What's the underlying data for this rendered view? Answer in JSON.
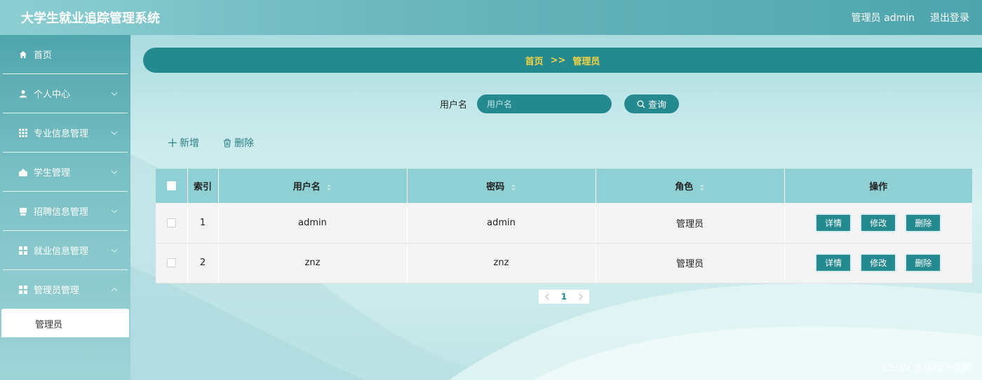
{
  "header": {
    "title": "大学生就业追踪管理系统",
    "user_label": "管理员 admin",
    "logout_label": "退出登录"
  },
  "sidebar": {
    "items": [
      {
        "label": "首页",
        "icon": "home-icon"
      },
      {
        "label": "个人中心",
        "icon": "user-icon"
      },
      {
        "label": "专业信息管理",
        "icon": "grid-icon"
      },
      {
        "label": "学生管理",
        "icon": "student-icon"
      },
      {
        "label": "招聘信息管理",
        "icon": "printer-icon"
      },
      {
        "label": "就业信息管理",
        "icon": "apps-icon"
      },
      {
        "label": "管理员管理",
        "icon": "apps-icon"
      }
    ],
    "active_sub": "管理员"
  },
  "breadcrumb": {
    "home": "首页",
    "separator": ">>",
    "current": "管理员"
  },
  "search": {
    "label": "用户名",
    "placeholder": "用户名",
    "button": "查询"
  },
  "actions": {
    "add": "新增",
    "delete": "删除"
  },
  "table": {
    "headers": {
      "index": "索引",
      "username": "用户名",
      "password": "密码",
      "role": "角色",
      "ops": "操作"
    },
    "rows": [
      {
        "index": "1",
        "username": "admin",
        "password": "admin",
        "role": "管理员"
      },
      {
        "index": "2",
        "username": "znz",
        "password": "znz",
        "role": "管理员"
      }
    ],
    "op_labels": {
      "detail": "详情",
      "edit": "修改",
      "delete": "删除"
    }
  },
  "pager": {
    "current": "1"
  },
  "watermark": "CSDN @编程千纸鹤",
  "colors": {
    "primary": "#248a8f",
    "header_row": "#8ed0d4",
    "breadcrumb_text": "#f5d343"
  }
}
